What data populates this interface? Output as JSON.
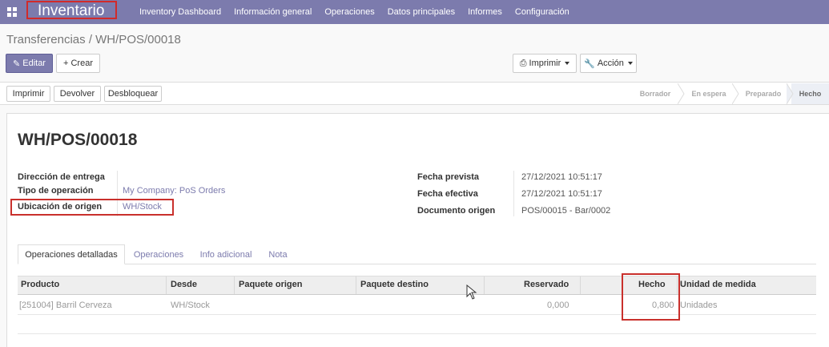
{
  "navbar": {
    "app_title": "Inventario",
    "menu": [
      "Inventory Dashboard",
      "Información general",
      "Operaciones",
      "Datos principales",
      "Informes",
      "Configuración"
    ]
  },
  "breadcrumb": "Transferencias / WH/POS/00018",
  "actions": {
    "edit": "Editar",
    "create": "+ Crear",
    "print": "Imprimir",
    "action": "Acción"
  },
  "statusbar": {
    "buttons": [
      "Imprimir",
      "Devolver",
      "Desbloquear"
    ],
    "stages": [
      "Borrador",
      "En espera",
      "Preparado",
      "Hecho"
    ],
    "active_stage": "Hecho"
  },
  "record": {
    "name": "WH/POS/00018",
    "left_fields": [
      {
        "label": "Dirección de entrega",
        "value": ""
      },
      {
        "label": "Tipo de operación",
        "value": "My Company: PoS Orders"
      },
      {
        "label": "Ubicación de origen",
        "value": "WH/Stock"
      }
    ],
    "right_fields": [
      {
        "label": "Fecha prevista",
        "value": "27/12/2021 10:51:17"
      },
      {
        "label": "Fecha efectiva",
        "value": "27/12/2021 10:51:17"
      },
      {
        "label": "Documento origen",
        "value": "POS/00015 - Bar/0002"
      }
    ]
  },
  "tabs": [
    "Operaciones detalladas",
    "Operaciones",
    "Info adicional",
    "Nota"
  ],
  "table": {
    "columns": [
      "Producto",
      "Desde",
      "Paquete origen",
      "Paquete destino",
      "Reservado",
      "Hecho",
      "Unidad de medida"
    ],
    "rows": [
      {
        "producto": "[251004] Barril Cerveza",
        "desde": "WH/Stock",
        "paquete_origen": "",
        "paquete_destino": "",
        "reservado": "0,000",
        "hecho": "0,800",
        "unidad": "Unidades"
      }
    ]
  },
  "colors": {
    "navbar": "#7c7bad",
    "highlight": "#c9302c"
  }
}
